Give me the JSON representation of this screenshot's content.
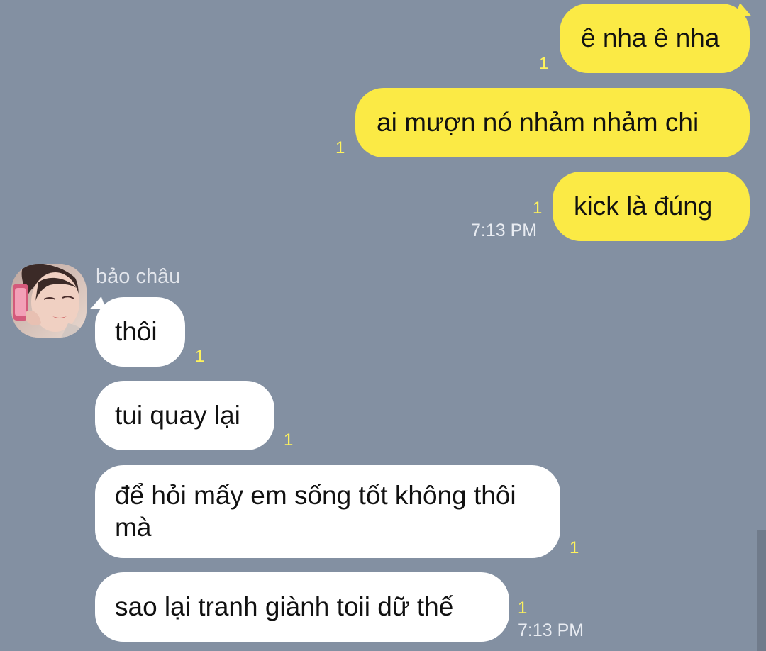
{
  "chat": {
    "outgoing": [
      {
        "text": "ê nha ê nha",
        "read_count": "1"
      },
      {
        "text": "ai mượn nó nhảm nhảm chi",
        "read_count": "1"
      },
      {
        "text": "kick là đúng",
        "read_count": "1",
        "time": "7:13 PM"
      }
    ],
    "incoming": {
      "sender": "bảo châu",
      "avatar_icon": "profile-photo",
      "messages": [
        {
          "text": "thôi",
          "read_count": "1"
        },
        {
          "text": "tui quay lại",
          "read_count": "1"
        },
        {
          "text": "để hỏi mấy em sống tốt không thôi mà",
          "read_count": "1"
        },
        {
          "text": "sao lại tranh giành toii dữ thế",
          "read_count": "1",
          "time": "7:13 PM"
        }
      ]
    }
  },
  "colors": {
    "background": "#8390a2",
    "outgoing_bubble": "#fbea45",
    "incoming_bubble": "#ffffff",
    "read_count": "#fff35c"
  }
}
